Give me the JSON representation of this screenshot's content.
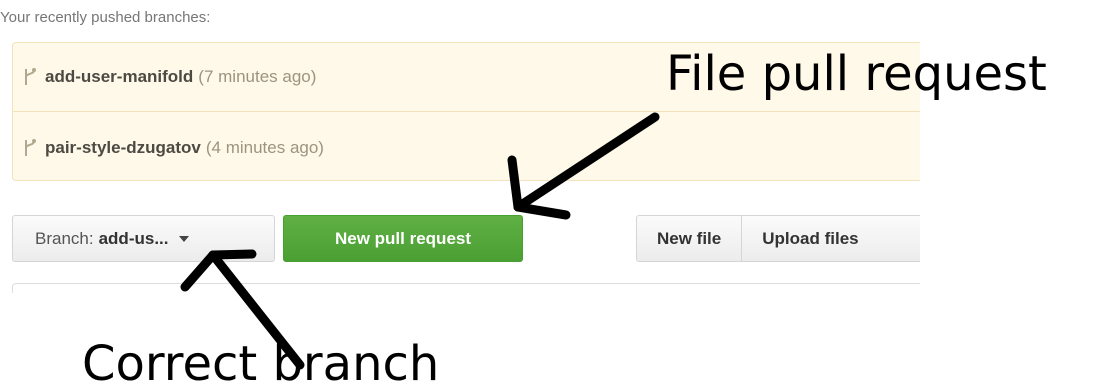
{
  "recent_branches": {
    "heading": "Your recently pushed branches:",
    "items": [
      {
        "name": "add-user-manifold",
        "time": "(7 minutes ago)"
      },
      {
        "name": "pair-style-dzugatov",
        "time": "(4 minutes ago)"
      }
    ]
  },
  "toolbar": {
    "branch_label": "Branch:",
    "branch_value": "add-us...",
    "new_pr_label": "New pull request",
    "new_file_label": "New file",
    "upload_label": "Upload files"
  },
  "annotations": {
    "file_pr": "File pull request",
    "correct_branch": "Correct branch"
  },
  "colors": {
    "green": "#4a9f33",
    "recent_bg": "#fff9ea"
  }
}
